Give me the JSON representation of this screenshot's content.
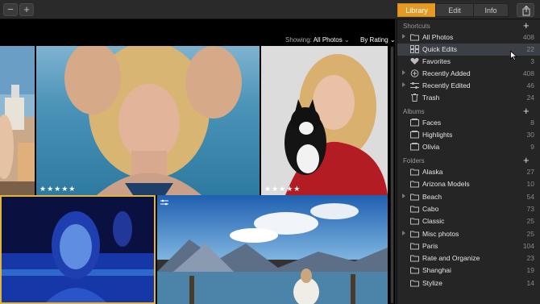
{
  "toolbar": {
    "zoom_out_label": "−",
    "zoom_in_label": "+",
    "tabs": [
      {
        "label": "Library",
        "active": true
      },
      {
        "label": "Edit",
        "active": false
      },
      {
        "label": "Info",
        "active": false
      }
    ],
    "share_icon": "share-icon",
    "accent_color": "#e59a23"
  },
  "viewbar": {
    "showing_label": "Showing:",
    "showing_value": "All Photos",
    "sort_value": "By Rating"
  },
  "photos": [
    {
      "name": "photo-beach-woman-partial",
      "rating": 0,
      "selected": false
    },
    {
      "name": "photo-woman-blonde-sea",
      "rating": 5,
      "stars": "★★★★★",
      "selected": false
    },
    {
      "name": "photo-woman-with-cat",
      "rating": 5,
      "stars": "★★★★★",
      "selected": false
    },
    {
      "name": "photo-woman-pool-blue",
      "rating": 0,
      "selected": true
    },
    {
      "name": "photo-lake-pier-mountains",
      "rating": 0,
      "selected": false,
      "edited": true
    }
  ],
  "sidebar": {
    "shortcuts": {
      "title": "Shortcuts",
      "items": [
        {
          "label": "All Photos",
          "count": "408",
          "icon": "folder-icon",
          "expandable": true,
          "selected": false
        },
        {
          "label": "Quick Edits",
          "count": "22",
          "icon": "grid-icon",
          "expandable": false,
          "selected": true
        },
        {
          "label": "Favorites",
          "count": "3",
          "icon": "heart-icon",
          "expandable": false,
          "selected": false
        },
        {
          "label": "Recently Added",
          "count": "408",
          "icon": "plus-circle-icon",
          "expandable": true,
          "selected": false
        },
        {
          "label": "Recently Edited",
          "count": "46",
          "icon": "sliders-icon",
          "expandable": true,
          "selected": false
        },
        {
          "label": "Trash",
          "count": "24",
          "icon": "trash-icon",
          "expandable": false,
          "selected": false
        }
      ]
    },
    "albums": {
      "title": "Albums",
      "items": [
        {
          "label": "Faces",
          "count": "8"
        },
        {
          "label": "Highlights",
          "count": "30"
        },
        {
          "label": "Olivia",
          "count": "9"
        }
      ]
    },
    "folders": {
      "title": "Folders",
      "items": [
        {
          "label": "Alaska",
          "count": "27",
          "expandable": false
        },
        {
          "label": "Arizona Models",
          "count": "10",
          "expandable": false
        },
        {
          "label": "Beach",
          "count": "54",
          "expandable": true
        },
        {
          "label": "Cabo",
          "count": "73",
          "expandable": false
        },
        {
          "label": "Classic",
          "count": "25",
          "expandable": false
        },
        {
          "label": "Misc photos",
          "count": "25",
          "expandable": true
        },
        {
          "label": "Paris",
          "count": "104",
          "expandable": false
        },
        {
          "label": "Rate and Organize",
          "count": "23",
          "expandable": false
        },
        {
          "label": "Shanghai",
          "count": "19",
          "expandable": false
        },
        {
          "label": "Stylize",
          "count": "14",
          "expandable": false
        }
      ]
    }
  }
}
